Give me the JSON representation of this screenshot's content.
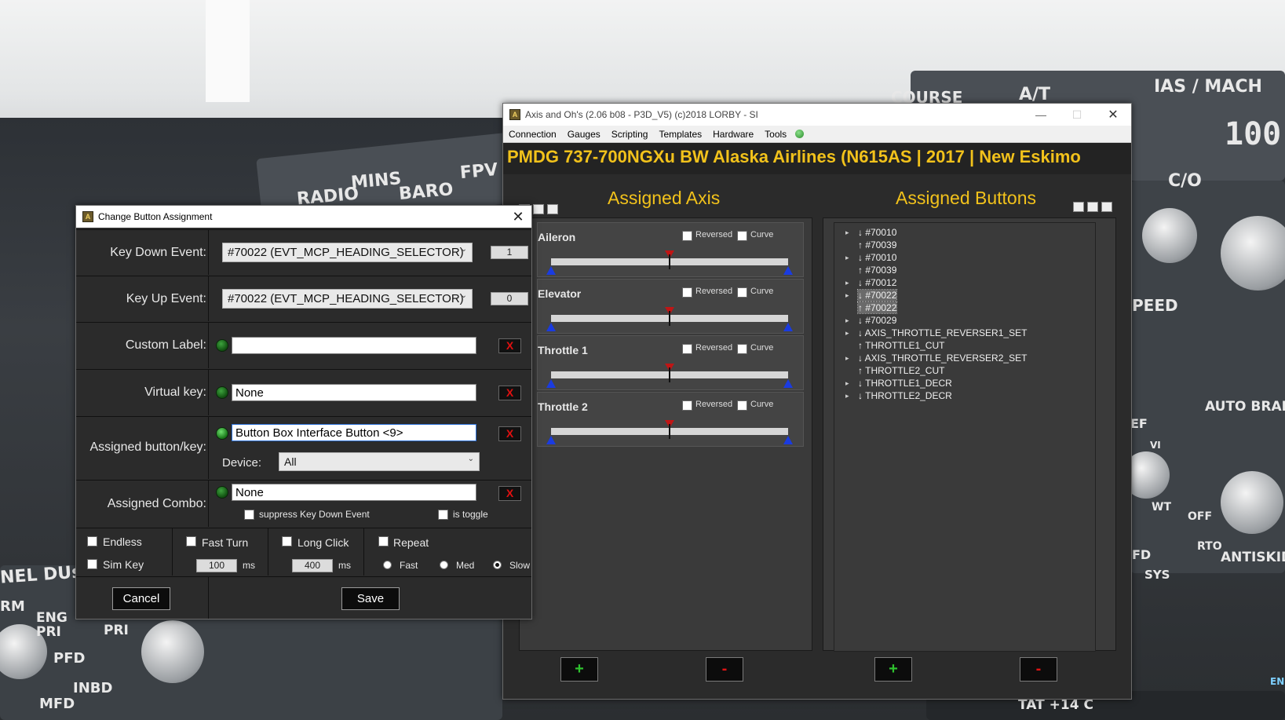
{
  "background": {
    "labels": {
      "radio": "RADIO",
      "mins": "MINS",
      "baro": "BARO",
      "fpv": "FPV",
      "course": "COURSE",
      "at": "A/T",
      "ias_mach": "IAS / MACH",
      "speed_value": "100",
      "co": "C/O",
      "peed": "PEED",
      "auto_brake": "AUTO BRAKE",
      "off": "OFF",
      "rto": "RTO",
      "antiskid": "ANTISKID",
      "sys": "SYS",
      "tat": "TAT +14 C",
      "nel_dus": "NEL DUs",
      "rm": "RM",
      "eng_pri": "ENG\nPRI",
      "pri": "PRI",
      "pfd": "PFD",
      "inbd": "INBD",
      "mfd": "MFD",
      "ef": "EF",
      "vi": "VI",
      "wt": "WT",
      "fd": "FD",
      "en": "EN"
    }
  },
  "dialog": {
    "title": "Change Button Assignment",
    "close_glyph": "✕",
    "key_down": {
      "label": "Key Down Event:",
      "value": "#70022 (EVT_MCP_HEADING_SELECTOR)",
      "number": "1"
    },
    "key_up": {
      "label": "Key Up Event:",
      "value": "#70022 (EVT_MCP_HEADING_SELECTOR)",
      "number": "0"
    },
    "custom_label": {
      "label": "Custom Label:",
      "value": ""
    },
    "virtual_key": {
      "label": "Virtual key:",
      "value": "None"
    },
    "assigned_button": {
      "label": "Assigned button/key:",
      "value": "Button Box Interface Button <9>"
    },
    "device": {
      "label": "Device:",
      "value": "All"
    },
    "assigned_combo": {
      "label": "Assigned Combo:",
      "value": "None",
      "suppress_label": "suppress Key Down Event",
      "toggle_label": "is toggle"
    },
    "clear_glyph": "X",
    "options": {
      "endless": "Endless",
      "sim_key": "Sim Key",
      "fast_turn": "Fast Turn",
      "fast_turn_ms": "100",
      "long_click": "Long Click",
      "long_click_ms": "400",
      "ms": "ms",
      "repeat": "Repeat",
      "fast": "Fast",
      "med": "Med",
      "slow": "Slow",
      "selected_speed": "Slow"
    },
    "cancel": "Cancel",
    "save": "Save"
  },
  "main": {
    "title": "Axis and Oh's (2.06 b08 - P3D_V5) (c)2018 LORBY - SI",
    "window_controls": {
      "minimize": "—",
      "maximize": "☐",
      "close": "✕"
    },
    "menu": [
      "Connection",
      "Gauges",
      "Scripting",
      "Templates",
      "Hardware",
      "Tools"
    ],
    "banner": "PMDG 737-700NGXu BW Alaska Airlines (N615AS | 2017 | New Eskimo",
    "axis_header": "Assigned Axis",
    "buttons_header": "Assigned Buttons",
    "axes": [
      {
        "name": "Aileron",
        "reversed": "Reversed",
        "curve": "Curve",
        "center": 0.5
      },
      {
        "name": "Elevator",
        "reversed": "Reversed",
        "curve": "Curve",
        "center": 0.5
      },
      {
        "name": "Throttle 1",
        "reversed": "Reversed",
        "curve": "Curve",
        "center": 0.5
      },
      {
        "name": "Throttle 2",
        "reversed": "Reversed",
        "curve": "Curve",
        "center": 0.5
      }
    ],
    "button_list": [
      {
        "expander": true,
        "text": "↓ #70010",
        "selected": false
      },
      {
        "expander": false,
        "text": "↑ #70039",
        "selected": false
      },
      {
        "expander": true,
        "text": "↓ #70010",
        "selected": false
      },
      {
        "expander": false,
        "text": "↑ #70039",
        "selected": false
      },
      {
        "expander": true,
        "text": "↓ #70012",
        "selected": false
      },
      {
        "expander": true,
        "text": "↓ #70022",
        "selected": true
      },
      {
        "expander": false,
        "text": "↑ #70022",
        "selected": true
      },
      {
        "expander": true,
        "text": "↓ #70029",
        "selected": false
      },
      {
        "expander": true,
        "text": "↓ AXIS_THROTTLE_REVERSER1_SET",
        "selected": false
      },
      {
        "expander": false,
        "text": "↑ THROTTLE1_CUT",
        "selected": false
      },
      {
        "expander": true,
        "text": "↓ AXIS_THROTTLE_REVERSER2_SET",
        "selected": false
      },
      {
        "expander": false,
        "text": "↑ THROTTLE2_CUT",
        "selected": false
      },
      {
        "expander": true,
        "text": "↓ THROTTLE1_DECR",
        "selected": false
      },
      {
        "expander": true,
        "text": "↓ THROTTLE2_DECR",
        "selected": false
      }
    ],
    "add_glyph": "+",
    "remove_glyph": "-"
  }
}
